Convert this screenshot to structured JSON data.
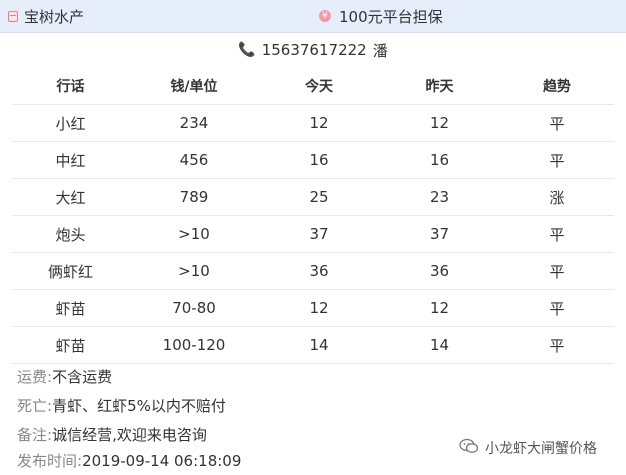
{
  "header": {
    "shop_name": "宝树水产",
    "guarantee": "100元平台担保"
  },
  "contact": {
    "phone": "15637617222",
    "name": "潘"
  },
  "table": {
    "columns": [
      "行话",
      "钱/单位",
      "今天",
      "昨天",
      "趋势"
    ],
    "rows": [
      [
        "小红",
        "234",
        "12",
        "12",
        "平"
      ],
      [
        "中红",
        "456",
        "16",
        "16",
        "平"
      ],
      [
        "大红",
        "789",
        "25",
        "23",
        "涨"
      ],
      [
        "炮头",
        ">10",
        "37",
        "37",
        "平"
      ],
      [
        "俩虾红",
        ">10",
        "36",
        "36",
        "平"
      ],
      [
        "虾苗",
        "70-80",
        "12",
        "12",
        "平"
      ],
      [
        "虾苗",
        "100-120",
        "14",
        "14",
        "平"
      ]
    ]
  },
  "info": {
    "shipping_label": "运费:",
    "shipping_value": "不含运费",
    "death_label": "死亡:",
    "death_value": "青虾、红虾5%以内不赔付",
    "note_label": "备注:",
    "note_value": "诚信经营,欢迎来电咨询",
    "published_label": "发布时间:",
    "published_value": "2019-09-14 06:18:09"
  },
  "watermark": {
    "text": "小龙虾大闸蟹价格",
    "icon": "wechat-icon"
  }
}
